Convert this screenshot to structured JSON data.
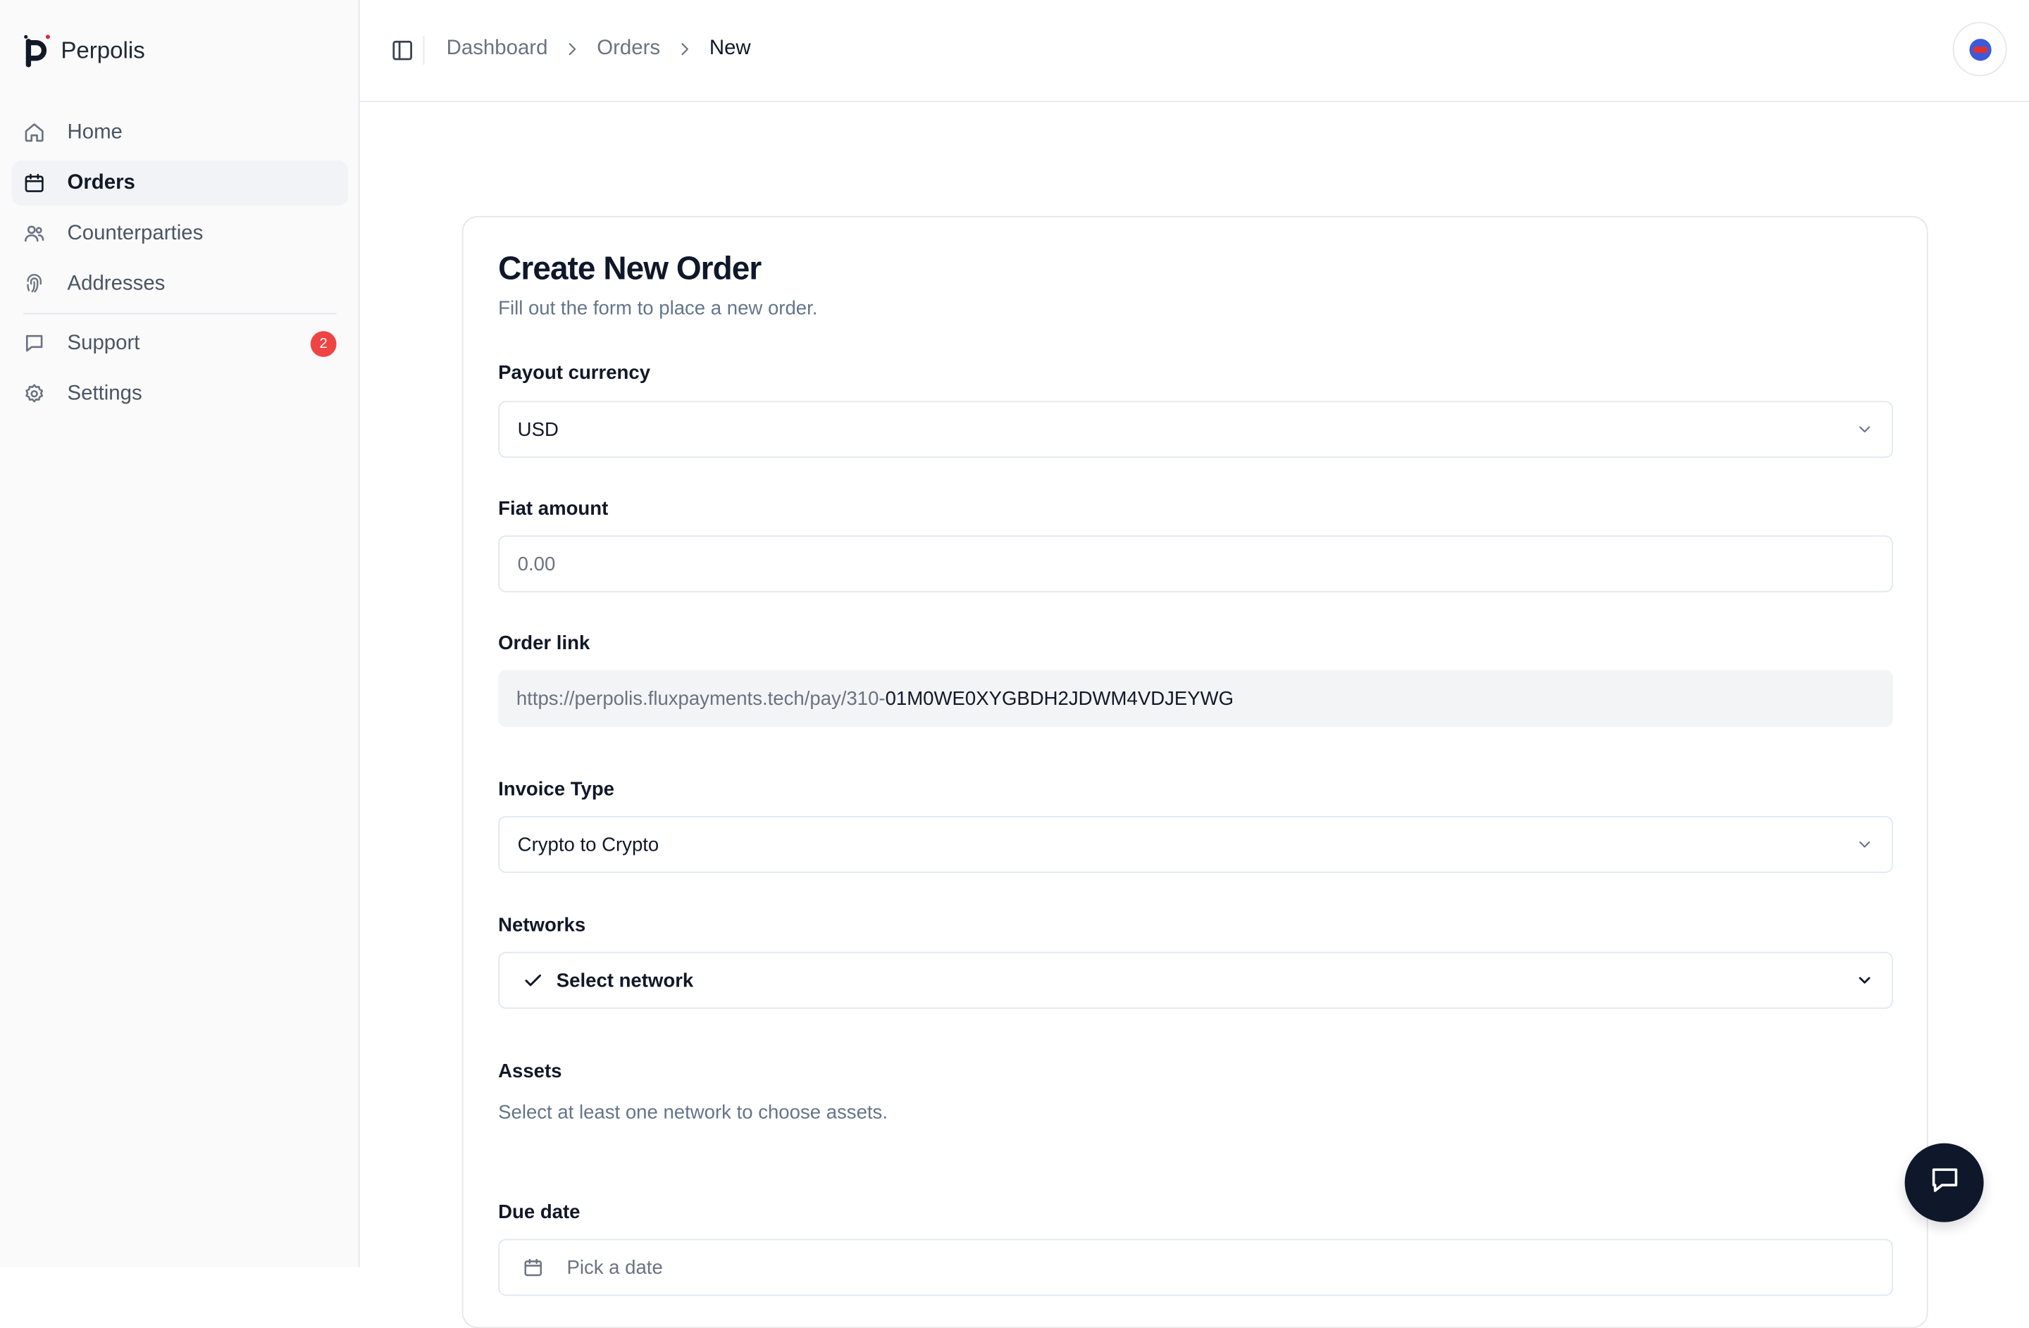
{
  "brand": {
    "name": "Perpolis",
    "accent": "#e11d48"
  },
  "sidebar": {
    "items": [
      {
        "label": "Home",
        "icon": "home-icon"
      },
      {
        "label": "Orders",
        "icon": "calendar-icon",
        "active": true
      },
      {
        "label": "Counterparties",
        "icon": "users-icon"
      },
      {
        "label": "Addresses",
        "icon": "fingerprint-icon"
      }
    ],
    "secondary": [
      {
        "label": "Support",
        "icon": "message-icon",
        "badge": "2"
      },
      {
        "label": "Settings",
        "icon": "gear-icon"
      }
    ]
  },
  "header": {
    "breadcrumb": [
      "Dashboard",
      "Orders",
      "New"
    ]
  },
  "form": {
    "title": "Create New Order",
    "description": "Fill out the form to place a new order.",
    "payout_currency": {
      "label": "Payout currency",
      "value": "USD"
    },
    "fiat_amount": {
      "label": "Fiat amount",
      "placeholder": "0.00"
    },
    "order_link": {
      "label": "Order link",
      "prefix": "https://perpolis.fluxpayments.tech/pay/310-",
      "value": "01M0WE0XYGBDH2JDWM4VDJEYWG"
    },
    "invoice_type": {
      "label": "Invoice Type",
      "value": "Crypto to Crypto"
    },
    "networks": {
      "label": "Networks",
      "value": "Select network"
    },
    "assets": {
      "label": "Assets",
      "hint": "Select at least one network to choose assets."
    },
    "due_date": {
      "label": "Due date",
      "placeholder": "Pick a date"
    }
  }
}
